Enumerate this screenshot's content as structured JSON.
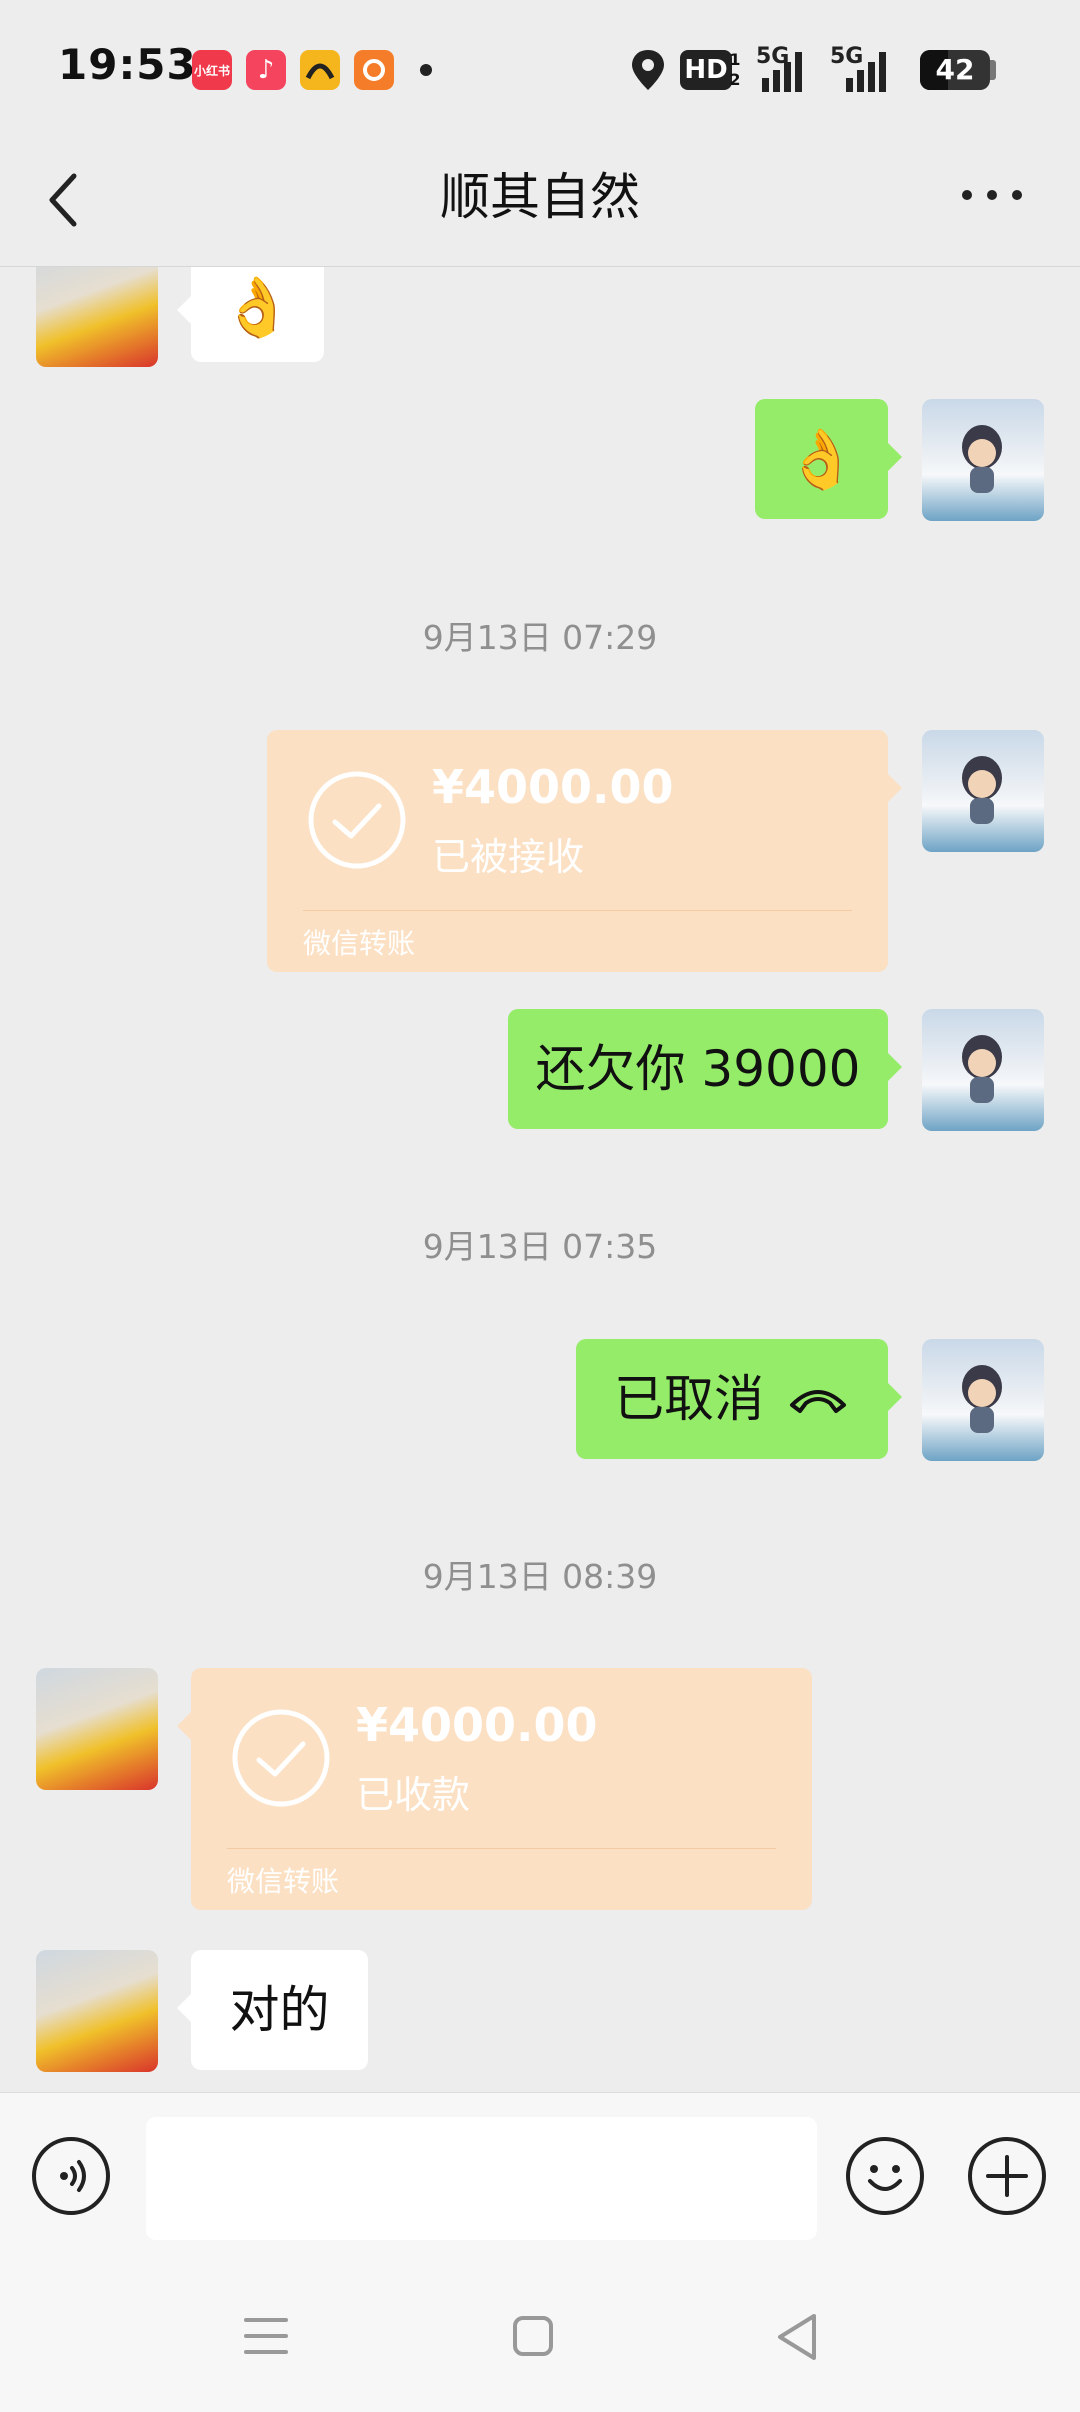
{
  "status_bar": {
    "time": "19:53",
    "app_icons": [
      {
        "name": "xiaohongshu-icon",
        "label": "小红书",
        "color": "#f03a4c"
      },
      {
        "name": "music-icon",
        "label": "♪",
        "color": "#f5445e"
      },
      {
        "name": "didi-icon",
        "label": "",
        "color": "#f5b51c"
      },
      {
        "name": "orange-app-icon",
        "label": "",
        "color": "#f57d2a"
      }
    ],
    "hd_label": "HD",
    "hd_sub": "1 2",
    "signal1_label": "5G",
    "signal2_label": "5G",
    "battery": "42"
  },
  "nav": {
    "title": "顺其自然"
  },
  "messages": {
    "m1_emoji": "👌",
    "m2_emoji": "👌",
    "ts1": "9月13日 07:29",
    "transfer1": {
      "amount": "¥4000.00",
      "status": "已被接收",
      "label": "微信转账"
    },
    "m3_text": "还欠你 39000",
    "ts2": "9月13日 07:35",
    "m4_text": "已取消",
    "ts3": "9月13日 08:39",
    "transfer2": {
      "amount": "¥4000.00",
      "status": "已收款",
      "label": "微信转账"
    },
    "m5_text": "对的"
  },
  "input": {
    "placeholder": ""
  },
  "colors": {
    "bubble_green": "#95ec69",
    "transfer_bg": "#fbe0c3",
    "background": "#ededed"
  }
}
